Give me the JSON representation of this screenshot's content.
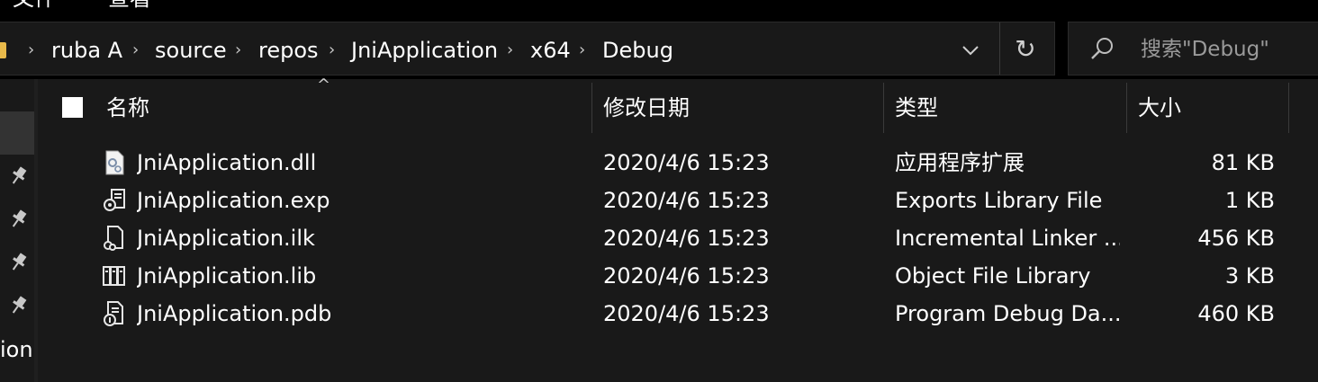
{
  "menu": {
    "items": [
      "文件",
      "查看"
    ]
  },
  "address": {
    "breadcrumbs": [
      "ruba A",
      "source",
      "repos",
      "JniApplication",
      "x64",
      "Debug"
    ],
    "separator": "›",
    "dropdown_glyph": "⌄",
    "refresh_glyph": "↻"
  },
  "search": {
    "placeholder": "搜索\"Debug\"",
    "value": ""
  },
  "nav": {
    "partial_text": "ion",
    "pins": 4
  },
  "columns": {
    "name": "名称",
    "modified": "修改日期",
    "type": "类型",
    "size": "大小",
    "sort_indicator": "^"
  },
  "files": [
    {
      "name": "JniApplication.dll",
      "modified": "2020/4/6 15:23",
      "type": "应用程序扩展",
      "size": "81 KB",
      "icon": "dll-file-icon"
    },
    {
      "name": "JniApplication.exp",
      "modified": "2020/4/6 15:23",
      "type": "Exports Library File",
      "size": "1 KB",
      "icon": "exp-file-icon"
    },
    {
      "name": "JniApplication.ilk",
      "modified": "2020/4/6 15:23",
      "type": "Incremental Linker ...",
      "size": "456 KB",
      "icon": "ilk-file-icon"
    },
    {
      "name": "JniApplication.lib",
      "modified": "2020/4/6 15:23",
      "type": "Object File Library",
      "size": "3 KB",
      "icon": "lib-file-icon"
    },
    {
      "name": "JniApplication.pdb",
      "modified": "2020/4/6 15:23",
      "type": "Program Debug Da...",
      "size": "460 KB",
      "icon": "pdb-file-icon"
    }
  ],
  "colors": {
    "background": "#191919",
    "chrome": "#000000",
    "folder": "#e8b94a",
    "text": "#ffffff",
    "muted_text": "#9a9a9a"
  }
}
